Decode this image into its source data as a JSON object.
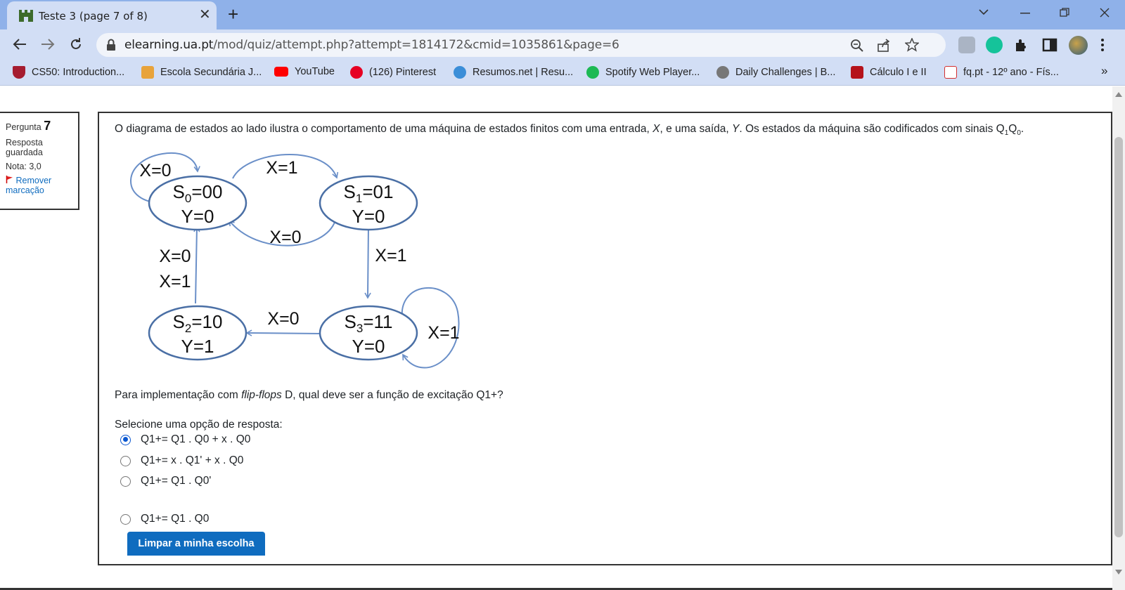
{
  "browser": {
    "tab_title": "Teste 3 (page 7 of 8)",
    "tab_close": "✕",
    "new_tab": "+",
    "url_host": "elearning.ua.pt",
    "url_path": "/mod/quiz/attempt.php?attempt=1814172&cmid=1035861&page=6",
    "bookmarks": [
      {
        "label": "CS50: Introduction...",
        "icon": "harvard-shield-icon",
        "color": "#a51c30"
      },
      {
        "label": "Escola Secundária J...",
        "icon": "school-icon",
        "color": "#e8a33b"
      },
      {
        "label": "YouTube",
        "icon": "youtube-icon",
        "color": "#ff0000"
      },
      {
        "label": "(126) Pinterest",
        "icon": "pinterest-icon",
        "color": "#e60023"
      },
      {
        "label": "Resumos.net | Resu...",
        "icon": "resumos-icon",
        "color": "#3b8ed8"
      },
      {
        "label": "Spotify Web Player...",
        "icon": "spotify-icon",
        "color": "#1db954"
      },
      {
        "label": "Daily Challenges | B...",
        "icon": "challenge-icon",
        "color": "#777777"
      },
      {
        "label": "Cálculo I e II",
        "icon": "calculo-icon",
        "color": "#b5121b"
      },
      {
        "label": "fq.pt - 12º ano - Fís...",
        "icon": "fq-icon",
        "color": "#d32f2f"
      }
    ],
    "bookmarks_more": "»"
  },
  "info": {
    "question_label": "Pergunta",
    "question_number": "7",
    "status": "Resposta guardada",
    "grade": "Nota: 3,0",
    "flag_label": "Remover marcação"
  },
  "question": {
    "text_before_x": "O diagrama de estados ao lado ilustra o comportamento de uma máquina de estados finitos com uma entrada, ",
    "x": "X",
    "text_mid": ", e uma saída, ",
    "y": "Y",
    "text_after": ". Os estados da máquina são codificados com sinais Q",
    "sub1": "1",
    "q0": "Q",
    "sub0": "0",
    "period": ".",
    "prompt_before": "Para implementação com ",
    "prompt_em": "flip-flops",
    "prompt_after": " D, qual deve ser a função de excitação Q1+?",
    "select_label": "Selecione uma opção de resposta:",
    "options": [
      {
        "label": "Q1+= Q1 . Q0 + x . Q0",
        "checked": true
      },
      {
        "label": "Q1+= x . Q1' + x . Q0",
        "checked": false
      },
      {
        "label": "Q1+= Q1 . Q0'",
        "checked": false
      },
      {
        "label": "Q1+= Q1 . Q0",
        "checked": false
      }
    ],
    "clear_button": "Limpar a minha escolha"
  },
  "diagram": {
    "states": [
      {
        "name": "S",
        "sub": "0",
        "code": "=00",
        "output": "Y=0"
      },
      {
        "name": "S",
        "sub": "1",
        "code": "=01",
        "output": "Y=0"
      },
      {
        "name": "S",
        "sub": "2",
        "code": "=10",
        "output": "Y=1"
      },
      {
        "name": "S",
        "sub": "3",
        "code": "=11",
        "output": "Y=0"
      }
    ],
    "transitions": {
      "s0_self": "X=0",
      "s0_to_s1": "X=1",
      "s1_to_s0": "X=0",
      "s1_to_s3": "X=1",
      "s2_to_s0_a": "X=0",
      "s2_to_s0_b": "X=1",
      "s3_to_s2": "X=0",
      "s3_self": "X=1"
    },
    "colors": {
      "stroke": "#4a6fa5",
      "arrow": "#6a8fc8",
      "text": "#111111"
    }
  }
}
